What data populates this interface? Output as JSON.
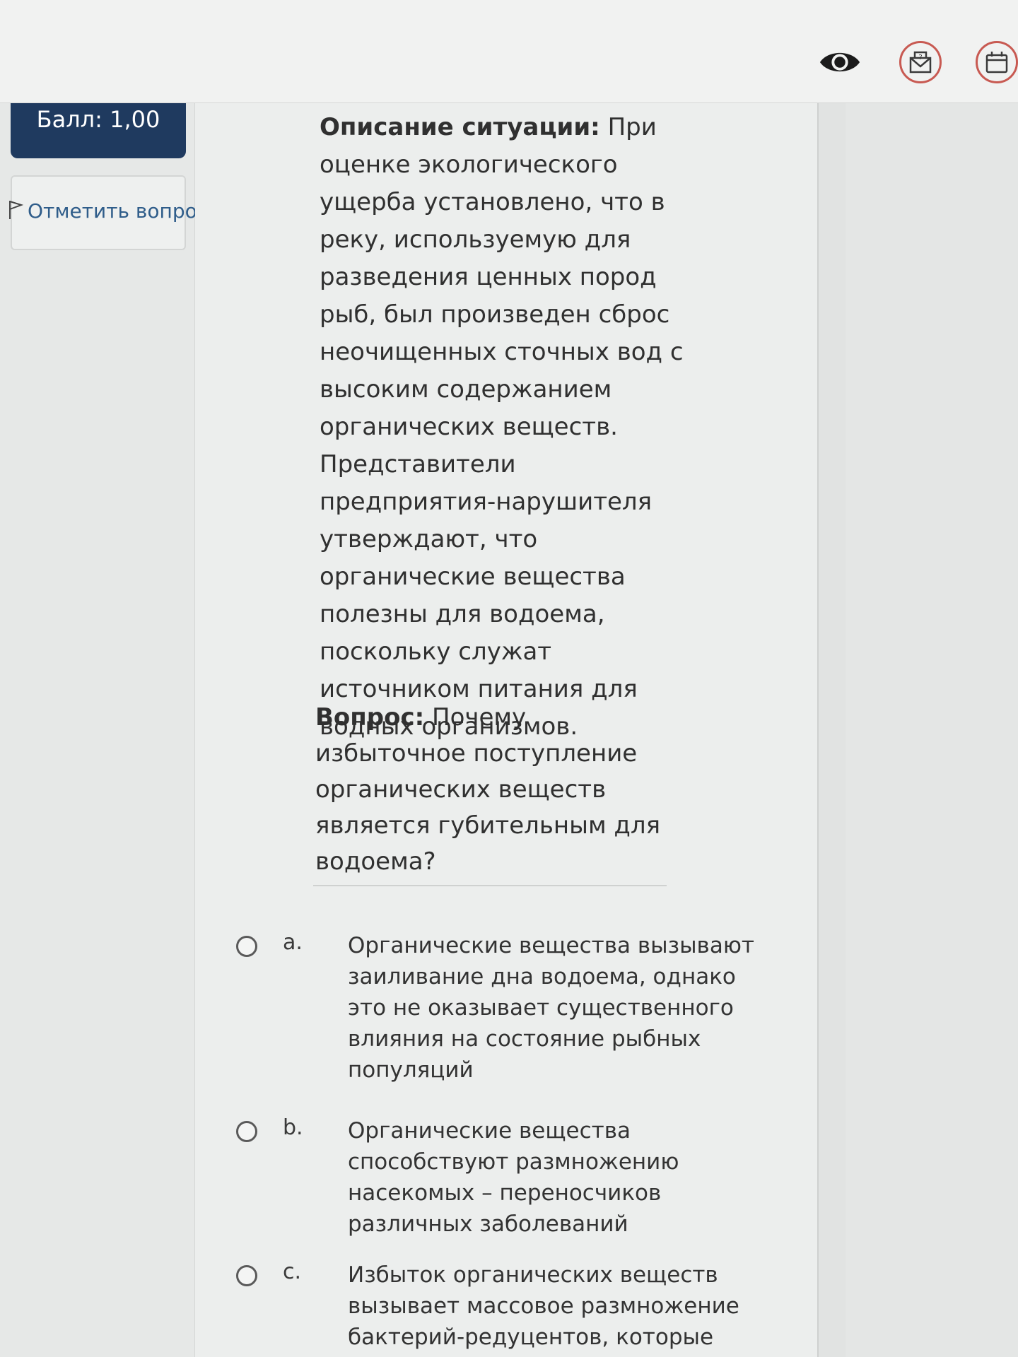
{
  "toolbar": {
    "icons": [
      "eye-icon",
      "mail-icon",
      "calendar-icon"
    ],
    "accent_color": "#c85a52"
  },
  "sidebar": {
    "score_label": "Балл: 1,00",
    "flag_label": "Отметить вопрос",
    "score_color": "#1f3a5f"
  },
  "question": {
    "situation_title": "Описание ситуации:",
    "situation_text": "При оценке экологического ущерба установлено, что в реку, используемую для разведения ценных пород рыб, был произведен сброс неочищенных сточных вод с высоким содержанием органических веществ. Представители предприятия-нарушителя утверждают, что органические вещества полезны для водоема, поскольку служат источником питания для водных организмов.",
    "question_title": "Вопрос:",
    "question_text": "Почему избыточное поступление органических веществ является губительным для водоема?"
  },
  "options": [
    {
      "letter": "a.",
      "text": "Органические вещества вызывают заиливание дна водоема, однако это не оказывает существенного влияния на состояние рыбных популяций"
    },
    {
      "letter": "b.",
      "text": "Органические вещества способствуют размножению насекомых – переносчиков различных заболеваний"
    },
    {
      "letter": "c.",
      "text": "Избыток органических веществ вызывает массовое размножение бактерий-редуцентов, которые"
    }
  ]
}
